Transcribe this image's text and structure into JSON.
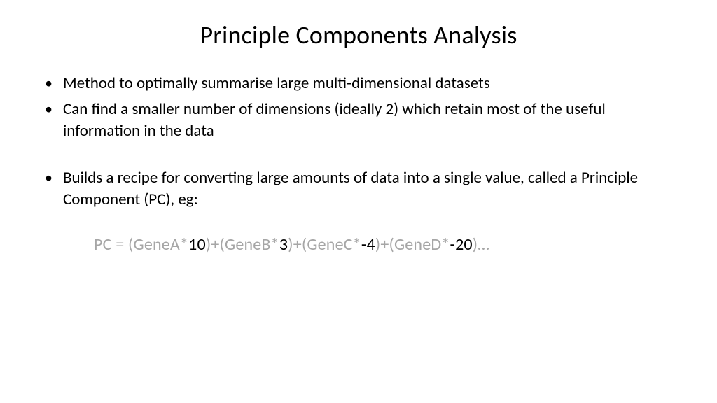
{
  "title": "Principle Components Analysis",
  "bullets": {
    "b1": "Method to optimally summarise large multi-dimensional datasets",
    "b2": "Can find a smaller number of dimensions (ideally 2) which retain most of the useful information in the data",
    "b3": "Builds a recipe for converting large amounts of data into a single value, called a Principle Component (PC), eg:"
  },
  "equation": {
    "p0": "PC = (GeneA*",
    "n0": "10",
    "p1": ")+(GeneB*",
    "n1": "3",
    "p2": ")+(GeneC*",
    "n2": "-4",
    "p3": ")+(GeneD*",
    "n3": "-20",
    "p4": ")…"
  }
}
